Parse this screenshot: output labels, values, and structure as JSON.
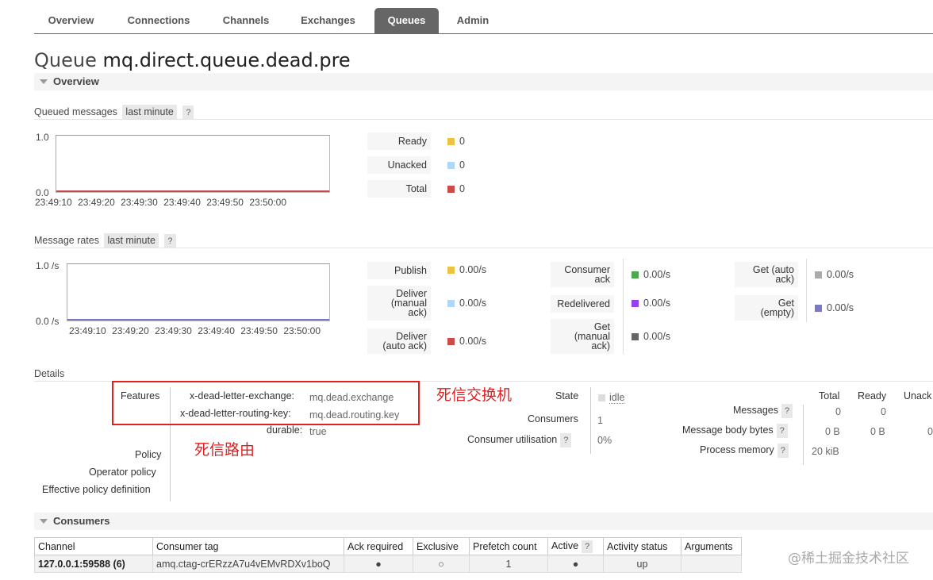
{
  "nav": {
    "tabs": [
      {
        "label": "Overview",
        "active": false
      },
      {
        "label": "Connections",
        "active": false
      },
      {
        "label": "Channels",
        "active": false
      },
      {
        "label": "Exchanges",
        "active": false
      },
      {
        "label": "Queues",
        "active": true
      },
      {
        "label": "Admin",
        "active": false
      }
    ]
  },
  "page": {
    "prefix": "Queue",
    "queue_name": "mq.direct.queue.dead.pre"
  },
  "overview": {
    "section_title": "Overview",
    "queued": {
      "title": "Queued messages",
      "range": "last minute",
      "help": "?",
      "y_top": "1.0",
      "y_bottom": "0.0",
      "ticks": [
        "23:49:10",
        "23:49:20",
        "23:49:30",
        "23:49:40",
        "23:49:50",
        "23:50:00"
      ],
      "legend": [
        {
          "label": "Ready",
          "value": "0",
          "color": "#edc240"
        },
        {
          "label": "Unacked",
          "value": "0",
          "color": "#afd8f8"
        },
        {
          "label": "Total",
          "value": "0",
          "color": "#cb4b4b"
        }
      ]
    },
    "rates": {
      "title": "Message rates",
      "range": "last minute",
      "help": "?",
      "y_top": "1.0 /s",
      "y_bottom": "0.0 /s",
      "ticks": [
        "23:49:10",
        "23:49:20",
        "23:49:30",
        "23:49:40",
        "23:49:50",
        "23:50:00"
      ],
      "col1": [
        {
          "label": "Publish",
          "value": "0.00/s",
          "color": "#edc240"
        },
        {
          "label": "Deliver (manual ack)",
          "lines": [
            "Deliver",
            "(manual",
            "ack)"
          ],
          "value": "0.00/s",
          "color": "#afd8f8"
        },
        {
          "label": "Deliver (auto ack)",
          "lines": [
            "Deliver",
            "(auto ack)"
          ],
          "value": "0.00/s",
          "color": "#cb4b4b"
        }
      ],
      "col2": [
        {
          "label": "Consumer ack",
          "lines": [
            "Consumer",
            "ack"
          ],
          "value": "0.00/s",
          "color": "#4da74d"
        },
        {
          "label": "Redelivered",
          "value": "0.00/s",
          "color": "#9440ed"
        },
        {
          "label": "Get (manual ack)",
          "lines": [
            "Get",
            "(manual",
            "ack)"
          ],
          "value": "0.00/s",
          "color": "#666666"
        }
      ],
      "col3": [
        {
          "label": "Get (auto ack)",
          "lines": [
            "Get (auto",
            "ack)"
          ],
          "value": "0.00/s",
          "color": "#aaaaaa"
        },
        {
          "label": "Get (empty)",
          "lines": [
            "Get",
            "(empty)"
          ],
          "value": "0.00/s",
          "color": "#7c79c3"
        }
      ]
    },
    "details": {
      "title": "Details",
      "features_label": "Features",
      "features": [
        {
          "key": "x-dead-letter-exchange:",
          "value": "mq.dead.exchange"
        },
        {
          "key": "x-dead-letter-routing-key:",
          "value": "mq.dead.routing.key"
        },
        {
          "key": "durable:",
          "value": "true"
        }
      ],
      "policy_label": "Policy",
      "operator_policy_label": "Operator policy",
      "effective_policy_label": "Effective policy definition",
      "state_label": "State",
      "state_value": "idle",
      "consumers_label": "Consumers",
      "consumers_value": "1",
      "utilisation_label": "Consumer utilisation",
      "utilisation_value": "0%",
      "stats_headers": [
        "Total",
        "Ready",
        "Unack"
      ],
      "stats_rows": [
        {
          "label": "Messages",
          "values": [
            "0",
            "0",
            ""
          ]
        },
        {
          "label": "Message body bytes",
          "values": [
            "0 B",
            "0 B",
            "0"
          ]
        },
        {
          "label": "Process memory",
          "values": [
            "20 kiB",
            "",
            ""
          ]
        }
      ]
    }
  },
  "annotations": {
    "exchange": "死信交换机",
    "routing": "死信路由"
  },
  "consumers": {
    "section_title": "Consumers",
    "headers": [
      "Channel",
      "Consumer tag",
      "Ack required",
      "Exclusive",
      "Prefetch count",
      "Active",
      "Activity status",
      "Arguments"
    ],
    "active_help": "?",
    "rows": [
      {
        "channel": "127.0.0.1:59588 (6)",
        "tag": "amq.ctag-crERzzA7u4vEMvRDXv1boQ",
        "ack": "●",
        "exclusive": "○",
        "prefetch": "1",
        "active": "●",
        "status": "up",
        "args": ""
      }
    ]
  },
  "watermark": "@稀土掘金技术社区"
}
